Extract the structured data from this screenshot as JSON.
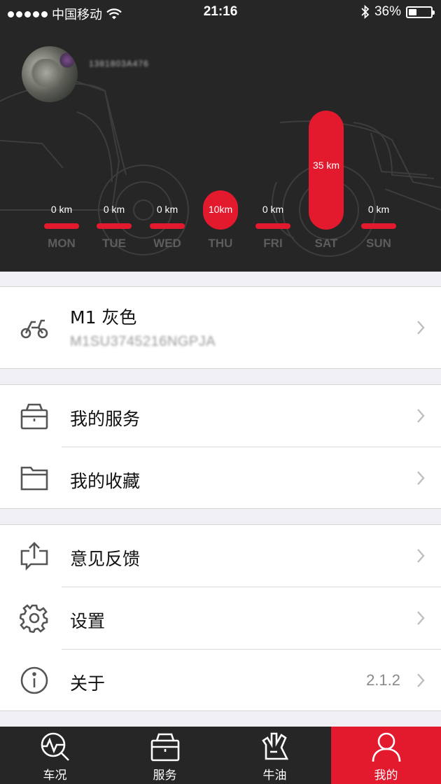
{
  "status_bar": {
    "carrier": "中国移动",
    "time": "21:16",
    "battery": "36%",
    "battery_level": 0.36,
    "icons": [
      "signal-dots-icon",
      "wifi-icon",
      "bluetooth-icon",
      "battery-icon"
    ]
  },
  "profile": {
    "user_id": "1381803A476",
    "avatar_icon": "avatar"
  },
  "weekly": {
    "max_km": 35,
    "days": [
      {
        "label": "MON",
        "km_text": "0 km",
        "km": 0
      },
      {
        "label": "TUE",
        "km_text": "0 km",
        "km": 0
      },
      {
        "label": "WED",
        "km_text": "0 km",
        "km": 0
      },
      {
        "label": "THU",
        "km_text": "10km",
        "km": 10
      },
      {
        "label": "FRI",
        "km_text": "0 km",
        "km": 0
      },
      {
        "label": "SAT",
        "km_text": "35 km",
        "km": 35
      },
      {
        "label": "SUN",
        "km_text": "0 km",
        "km": 0
      }
    ]
  },
  "vehicle": {
    "name": "M1  灰色",
    "serial": "M1SU3745216NGPJA",
    "icon": "scooter-icon"
  },
  "menu": {
    "services": {
      "label": "我的服务",
      "icon": "toolbox-icon"
    },
    "favorites": {
      "label": "我的收藏",
      "icon": "folder-icon"
    },
    "feedback": {
      "label": "意见反馈",
      "icon": "feedback-icon"
    },
    "settings": {
      "label": "设置",
      "icon": "gear-icon"
    },
    "about": {
      "label": "关于",
      "icon": "info-icon",
      "value": "2.1.2"
    }
  },
  "tabbar": {
    "tabs": [
      {
        "label": "车况",
        "icon": "vehicle-status-icon"
      },
      {
        "label": "服务",
        "icon": "service-icon"
      },
      {
        "label": "牛油",
        "icon": "community-icon"
      },
      {
        "label": "我的",
        "icon": "profile-icon",
        "active": true
      }
    ],
    "active_color": "#e3192e"
  },
  "colors": {
    "accent": "#e3192e",
    "header_bg": "#262626",
    "page_bg": "#efeff4"
  }
}
